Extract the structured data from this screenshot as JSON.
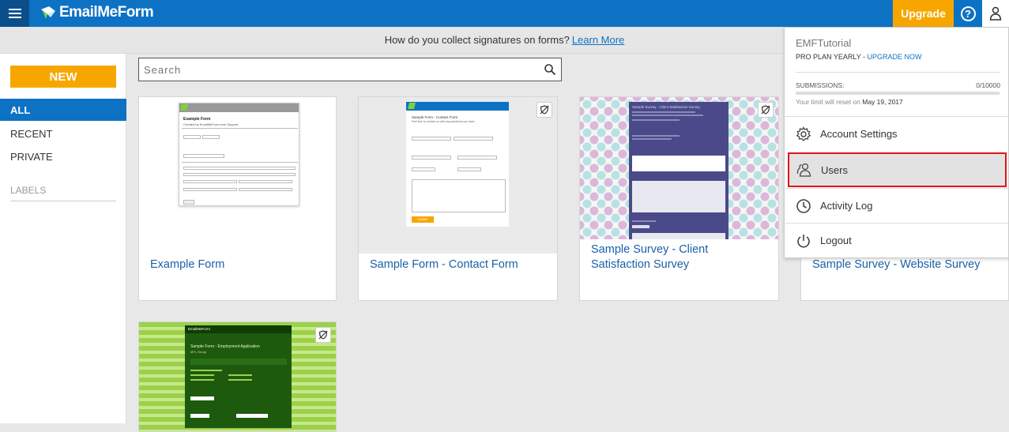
{
  "app": {
    "name": "EmailMeForm"
  },
  "topbar": {
    "upgrade_label": "Upgrade",
    "help_label": "?"
  },
  "notice": {
    "text": "How do you collect signatures on forms?",
    "link": "Learn More"
  },
  "sidebar": {
    "new_label": "NEW",
    "items": [
      {
        "label": "ALL",
        "active": true
      },
      {
        "label": "RECENT",
        "active": false
      },
      {
        "label": "PRIVATE",
        "active": false
      }
    ],
    "labels_heading": "LABELS"
  },
  "search": {
    "placeholder": "Search"
  },
  "forms": [
    {
      "title": "Example Form"
    },
    {
      "title": "Sample Form - Contact Form"
    },
    {
      "title": "Sample Survey - Client Satisfaction Survey"
    },
    {
      "title": "Sample Survey - Website Survey"
    },
    {
      "title": ""
    }
  ],
  "thumbs": {
    "example": {
      "title": "Example Form",
      "subtitle": "Created by EmailMeForm.com Support"
    },
    "contact": {
      "title": "Sample Form - Contact Form",
      "subtitle": "Feel free to contact us with any questions you have.",
      "submit": "SUBMIT"
    },
    "survey": {
      "title": "Sample Survey - Client Satisfaction Survey"
    },
    "employment": {
      "title": "Sample Form - Employment Application",
      "subtitle": "MTL Group",
      "brand": "EmailMeForm"
    }
  },
  "account_menu": {
    "username": "EMFTutorial",
    "plan": "PRO PLAN YEARLY - ",
    "upgrade_link": "UPGRADE NOW",
    "submissions_label": "SUBMISSIONS:",
    "submissions_value": "0/10000",
    "submissions_used_fraction": 0,
    "reset_text": "Your limit will reset on ",
    "reset_date": "May 19, 2017",
    "items": [
      {
        "label": "Account Settings",
        "icon": "gear-icon"
      },
      {
        "label": "Users",
        "icon": "users-icon"
      },
      {
        "label": "Activity Log",
        "icon": "clock-icon"
      },
      {
        "label": "Logout",
        "icon": "power-icon"
      }
    ],
    "highlighted_item": "Users"
  },
  "colors": {
    "brand_blue": "#0d72c4",
    "accent_orange": "#f7a600",
    "highlight_red": "#e0121a",
    "survey_purple": "#4a4a8a",
    "employment_green": "#1d5a0e"
  }
}
